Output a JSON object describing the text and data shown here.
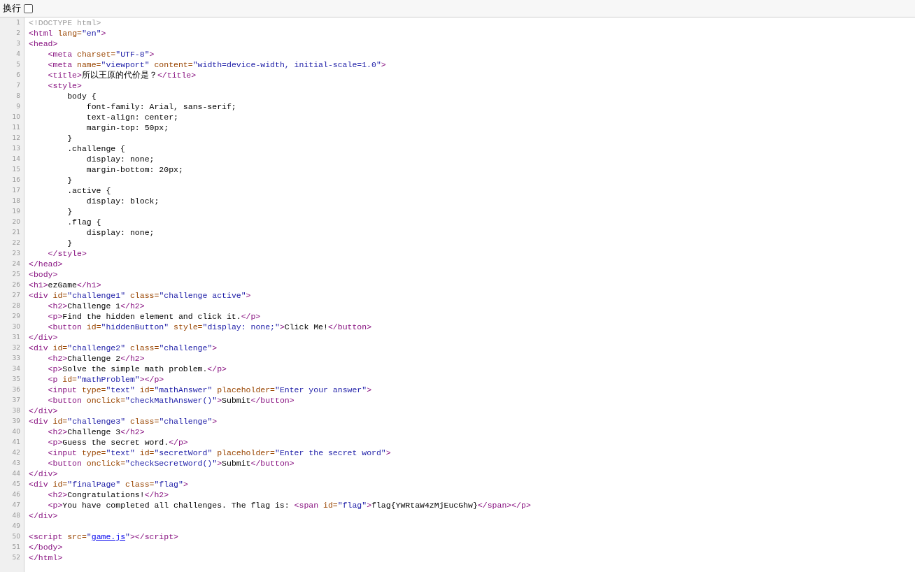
{
  "toolbar": {
    "wrap_label": "换行",
    "wrap_checked": false
  },
  "lines": [
    {
      "number": "1",
      "tokens": [
        {
          "kind": "doctype",
          "text": "<!DOCTYPE html>"
        }
      ]
    },
    {
      "number": "2",
      "tokens": [
        {
          "kind": "tag",
          "text": "<html "
        },
        {
          "kind": "attr",
          "text": "lang="
        },
        {
          "kind": "value",
          "text": "\"en\""
        },
        {
          "kind": "tag",
          "text": ">"
        }
      ]
    },
    {
      "number": "3",
      "tokens": [
        {
          "kind": "tag",
          "text": "<head>"
        }
      ]
    },
    {
      "number": "4",
      "tokens": [
        {
          "kind": "tag",
          "text": "    <meta "
        },
        {
          "kind": "attr",
          "text": "charset="
        },
        {
          "kind": "value",
          "text": "\"UTF-8\""
        },
        {
          "kind": "tag",
          "text": ">"
        }
      ]
    },
    {
      "number": "5",
      "tokens": [
        {
          "kind": "tag",
          "text": "    <meta "
        },
        {
          "kind": "attr",
          "text": "name="
        },
        {
          "kind": "value",
          "text": "\"viewport\""
        },
        {
          "kind": "attr",
          "text": " content="
        },
        {
          "kind": "value",
          "text": "\"width=device-width, initial-scale=1.0\""
        },
        {
          "kind": "tag",
          "text": ">"
        }
      ]
    },
    {
      "number": "6",
      "tokens": [
        {
          "kind": "tag",
          "text": "    <title>"
        },
        {
          "kind": "text",
          "text": "所以王原的代价是？"
        },
        {
          "kind": "tag",
          "text": "</title>"
        }
      ]
    },
    {
      "number": "7",
      "tokens": [
        {
          "kind": "tag",
          "text": "    <style>"
        }
      ]
    },
    {
      "number": "8",
      "tokens": [
        {
          "kind": "text",
          "text": "        body {"
        }
      ]
    },
    {
      "number": "9",
      "tokens": [
        {
          "kind": "text",
          "text": "            font-family: Arial, sans-serif;"
        }
      ]
    },
    {
      "number": "10",
      "tokens": [
        {
          "kind": "text",
          "text": "            text-align: center;"
        }
      ]
    },
    {
      "number": "11",
      "tokens": [
        {
          "kind": "text",
          "text": "            margin-top: 50px;"
        }
      ]
    },
    {
      "number": "12",
      "tokens": [
        {
          "kind": "text",
          "text": "        }"
        }
      ]
    },
    {
      "number": "13",
      "tokens": [
        {
          "kind": "text",
          "text": "        .challenge {"
        }
      ]
    },
    {
      "number": "14",
      "tokens": [
        {
          "kind": "text",
          "text": "            display: none;"
        }
      ]
    },
    {
      "number": "15",
      "tokens": [
        {
          "kind": "text",
          "text": "            margin-bottom: 20px;"
        }
      ]
    },
    {
      "number": "16",
      "tokens": [
        {
          "kind": "text",
          "text": "        }"
        }
      ]
    },
    {
      "number": "17",
      "tokens": [
        {
          "kind": "text",
          "text": "        .active {"
        }
      ]
    },
    {
      "number": "18",
      "tokens": [
        {
          "kind": "text",
          "text": "            display: block;"
        }
      ]
    },
    {
      "number": "19",
      "tokens": [
        {
          "kind": "text",
          "text": "        }"
        }
      ]
    },
    {
      "number": "20",
      "tokens": [
        {
          "kind": "text",
          "text": "        .flag {"
        }
      ]
    },
    {
      "number": "21",
      "tokens": [
        {
          "kind": "text",
          "text": "            display: none;"
        }
      ]
    },
    {
      "number": "22",
      "tokens": [
        {
          "kind": "text",
          "text": "        }"
        }
      ]
    },
    {
      "number": "23",
      "tokens": [
        {
          "kind": "tag",
          "text": "    </style>"
        }
      ]
    },
    {
      "number": "24",
      "tokens": [
        {
          "kind": "tag",
          "text": "</head>"
        }
      ]
    },
    {
      "number": "25",
      "tokens": [
        {
          "kind": "tag",
          "text": "<body>"
        }
      ]
    },
    {
      "number": "26",
      "tokens": [
        {
          "kind": "tag",
          "text": "<h1>"
        },
        {
          "kind": "text",
          "text": "ezGame"
        },
        {
          "kind": "tag",
          "text": "</h1>"
        }
      ]
    },
    {
      "number": "27",
      "tokens": [
        {
          "kind": "tag",
          "text": "<div "
        },
        {
          "kind": "attr",
          "text": "id="
        },
        {
          "kind": "value",
          "text": "\"challenge1\""
        },
        {
          "kind": "attr",
          "text": " class="
        },
        {
          "kind": "value",
          "text": "\"challenge active\""
        },
        {
          "kind": "tag",
          "text": ">"
        }
      ]
    },
    {
      "number": "28",
      "tokens": [
        {
          "kind": "tag",
          "text": "    <h2>"
        },
        {
          "kind": "text",
          "text": "Challenge 1"
        },
        {
          "kind": "tag",
          "text": "</h2>"
        }
      ]
    },
    {
      "number": "29",
      "tokens": [
        {
          "kind": "tag",
          "text": "    <p>"
        },
        {
          "kind": "text",
          "text": "Find the hidden element and click it."
        },
        {
          "kind": "tag",
          "text": "</p>"
        }
      ]
    },
    {
      "number": "30",
      "tokens": [
        {
          "kind": "tag",
          "text": "    <button "
        },
        {
          "kind": "attr",
          "text": "id="
        },
        {
          "kind": "value",
          "text": "\"hiddenButton\""
        },
        {
          "kind": "attr",
          "text": " style="
        },
        {
          "kind": "value",
          "text": "\"display: none;\""
        },
        {
          "kind": "tag",
          "text": ">"
        },
        {
          "kind": "text",
          "text": "Click Me!"
        },
        {
          "kind": "tag",
          "text": "</button>"
        }
      ]
    },
    {
      "number": "31",
      "tokens": [
        {
          "kind": "tag",
          "text": "</div>"
        }
      ]
    },
    {
      "number": "32",
      "tokens": [
        {
          "kind": "tag",
          "text": "<div "
        },
        {
          "kind": "attr",
          "text": "id="
        },
        {
          "kind": "value",
          "text": "\"challenge2\""
        },
        {
          "kind": "attr",
          "text": " class="
        },
        {
          "kind": "value",
          "text": "\"challenge\""
        },
        {
          "kind": "tag",
          "text": ">"
        }
      ]
    },
    {
      "number": "33",
      "tokens": [
        {
          "kind": "tag",
          "text": "    <h2>"
        },
        {
          "kind": "text",
          "text": "Challenge 2"
        },
        {
          "kind": "tag",
          "text": "</h2>"
        }
      ]
    },
    {
      "number": "34",
      "tokens": [
        {
          "kind": "tag",
          "text": "    <p>"
        },
        {
          "kind": "text",
          "text": "Solve the simple math problem."
        },
        {
          "kind": "tag",
          "text": "</p>"
        }
      ]
    },
    {
      "number": "35",
      "tokens": [
        {
          "kind": "tag",
          "text": "    <p "
        },
        {
          "kind": "attr",
          "text": "id="
        },
        {
          "kind": "value",
          "text": "\"mathProblem\""
        },
        {
          "kind": "tag",
          "text": "></p>"
        }
      ]
    },
    {
      "number": "36",
      "tokens": [
        {
          "kind": "tag",
          "text": "    <input "
        },
        {
          "kind": "attr",
          "text": "type="
        },
        {
          "kind": "value",
          "text": "\"text\""
        },
        {
          "kind": "attr",
          "text": " id="
        },
        {
          "kind": "value",
          "text": "\"mathAnswer\""
        },
        {
          "kind": "attr",
          "text": " placeholder="
        },
        {
          "kind": "value",
          "text": "\"Enter your answer\""
        },
        {
          "kind": "tag",
          "text": ">"
        }
      ]
    },
    {
      "number": "37",
      "tokens": [
        {
          "kind": "tag",
          "text": "    <button "
        },
        {
          "kind": "attr",
          "text": "onclick="
        },
        {
          "kind": "value",
          "text": "\"checkMathAnswer()\""
        },
        {
          "kind": "tag",
          "text": ">"
        },
        {
          "kind": "text",
          "text": "Submit"
        },
        {
          "kind": "tag",
          "text": "</button>"
        }
      ]
    },
    {
      "number": "38",
      "tokens": [
        {
          "kind": "tag",
          "text": "</div>"
        }
      ]
    },
    {
      "number": "39",
      "tokens": [
        {
          "kind": "tag",
          "text": "<div "
        },
        {
          "kind": "attr",
          "text": "id="
        },
        {
          "kind": "value",
          "text": "\"challenge3\""
        },
        {
          "kind": "attr",
          "text": " class="
        },
        {
          "kind": "value",
          "text": "\"challenge\""
        },
        {
          "kind": "tag",
          "text": ">"
        }
      ]
    },
    {
      "number": "40",
      "tokens": [
        {
          "kind": "tag",
          "text": "    <h2>"
        },
        {
          "kind": "text",
          "text": "Challenge 3"
        },
        {
          "kind": "tag",
          "text": "</h2>"
        }
      ]
    },
    {
      "number": "41",
      "tokens": [
        {
          "kind": "tag",
          "text": "    <p>"
        },
        {
          "kind": "text",
          "text": "Guess the secret word."
        },
        {
          "kind": "tag",
          "text": "</p>"
        }
      ]
    },
    {
      "number": "42",
      "tokens": [
        {
          "kind": "tag",
          "text": "    <input "
        },
        {
          "kind": "attr",
          "text": "type="
        },
        {
          "kind": "value",
          "text": "\"text\""
        },
        {
          "kind": "attr",
          "text": " id="
        },
        {
          "kind": "value",
          "text": "\"secretWord\""
        },
        {
          "kind": "attr",
          "text": " placeholder="
        },
        {
          "kind": "value",
          "text": "\"Enter the secret word\""
        },
        {
          "kind": "tag",
          "text": ">"
        }
      ]
    },
    {
      "number": "43",
      "tokens": [
        {
          "kind": "tag",
          "text": "    <button "
        },
        {
          "kind": "attr",
          "text": "onclick="
        },
        {
          "kind": "value",
          "text": "\"checkSecretWord()\""
        },
        {
          "kind": "tag",
          "text": ">"
        },
        {
          "kind": "text",
          "text": "Submit"
        },
        {
          "kind": "tag",
          "text": "</button>"
        }
      ]
    },
    {
      "number": "44",
      "tokens": [
        {
          "kind": "tag",
          "text": "</div>"
        }
      ]
    },
    {
      "number": "45",
      "tokens": [
        {
          "kind": "tag",
          "text": "<div "
        },
        {
          "kind": "attr",
          "text": "id="
        },
        {
          "kind": "value",
          "text": "\"finalPage\""
        },
        {
          "kind": "attr",
          "text": " class="
        },
        {
          "kind": "value",
          "text": "\"flag\""
        },
        {
          "kind": "tag",
          "text": ">"
        }
      ]
    },
    {
      "number": "46",
      "tokens": [
        {
          "kind": "tag",
          "text": "    <h2>"
        },
        {
          "kind": "text",
          "text": "Congratulations!"
        },
        {
          "kind": "tag",
          "text": "</h2>"
        }
      ]
    },
    {
      "number": "47",
      "tokens": [
        {
          "kind": "tag",
          "text": "    <p>"
        },
        {
          "kind": "text",
          "text": "You have completed all challenges. The flag is: "
        },
        {
          "kind": "tag",
          "text": "<span "
        },
        {
          "kind": "attr",
          "text": "id="
        },
        {
          "kind": "value",
          "text": "\"flag\""
        },
        {
          "kind": "tag",
          "text": ">"
        },
        {
          "kind": "text",
          "text": "flag{YWRtaW4zMjEucGhw}"
        },
        {
          "kind": "tag",
          "text": "</span></p>"
        }
      ]
    },
    {
      "number": "48",
      "tokens": [
        {
          "kind": "tag",
          "text": "</div>"
        }
      ]
    },
    {
      "number": "49"
    },
    {
      "number": "50",
      "tokens": [
        {
          "kind": "tag",
          "text": "<script "
        },
        {
          "kind": "attr",
          "text": "src="
        },
        {
          "kind": "value",
          "text": "\""
        },
        {
          "kind": "link",
          "text": "game.js"
        },
        {
          "kind": "value",
          "text": "\""
        },
        {
          "kind": "tag",
          "text": "></script>"
        }
      ]
    },
    {
      "number": "51",
      "tokens": [
        {
          "kind": "tag",
          "text": "</body>"
        }
      ]
    },
    {
      "number": "52",
      "tokens": [
        {
          "kind": "tag",
          "text": "</html>"
        }
      ]
    }
  ]
}
